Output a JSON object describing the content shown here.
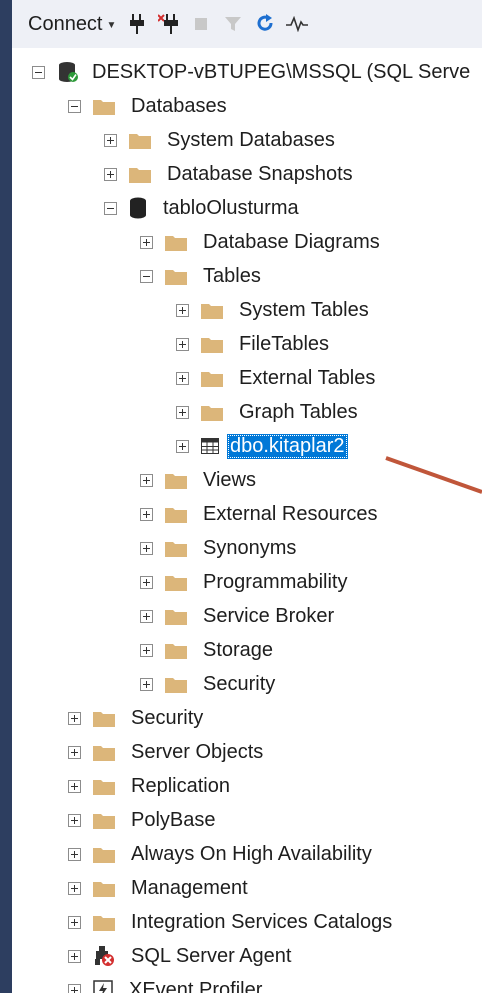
{
  "toolbar": {
    "connect_label": "Connect",
    "icons": [
      "connect-plug-icon",
      "disconnect-plug-icon",
      "stop-icon",
      "filter-icon",
      "refresh-icon",
      "activity-monitor-icon"
    ]
  },
  "tree": {
    "server": "DESKTOP-vBTUPEG\\MSSQL (SQL Serve",
    "databases": "Databases",
    "system_databases": "System Databases",
    "database_snapshots": "Database Snapshots",
    "db_name": "tabloOlusturma",
    "db_diagrams": "Database Diagrams",
    "tables": "Tables",
    "system_tables": "System Tables",
    "file_tables": "FileTables",
    "external_tables": "External Tables",
    "graph_tables": "Graph Tables",
    "selected_table": "dbo.kitaplar2",
    "views": "Views",
    "external_resources": "External Resources",
    "synonyms": "Synonyms",
    "programmability": "Programmability",
    "service_broker": "Service Broker",
    "storage": "Storage",
    "db_security": "Security",
    "security": "Security",
    "server_objects": "Server Objects",
    "replication": "Replication",
    "polybase": "PolyBase",
    "always_on": "Always On High Availability",
    "management": "Management",
    "integration_services": "Integration Services Catalogs",
    "sql_agent": "SQL Server Agent",
    "xevent_profiler": "XEvent Profiler"
  },
  "colors": {
    "folder": "#dcb67a",
    "selection": "#0078d7",
    "arrow": "#c0563a",
    "background": "#2d3e60"
  }
}
